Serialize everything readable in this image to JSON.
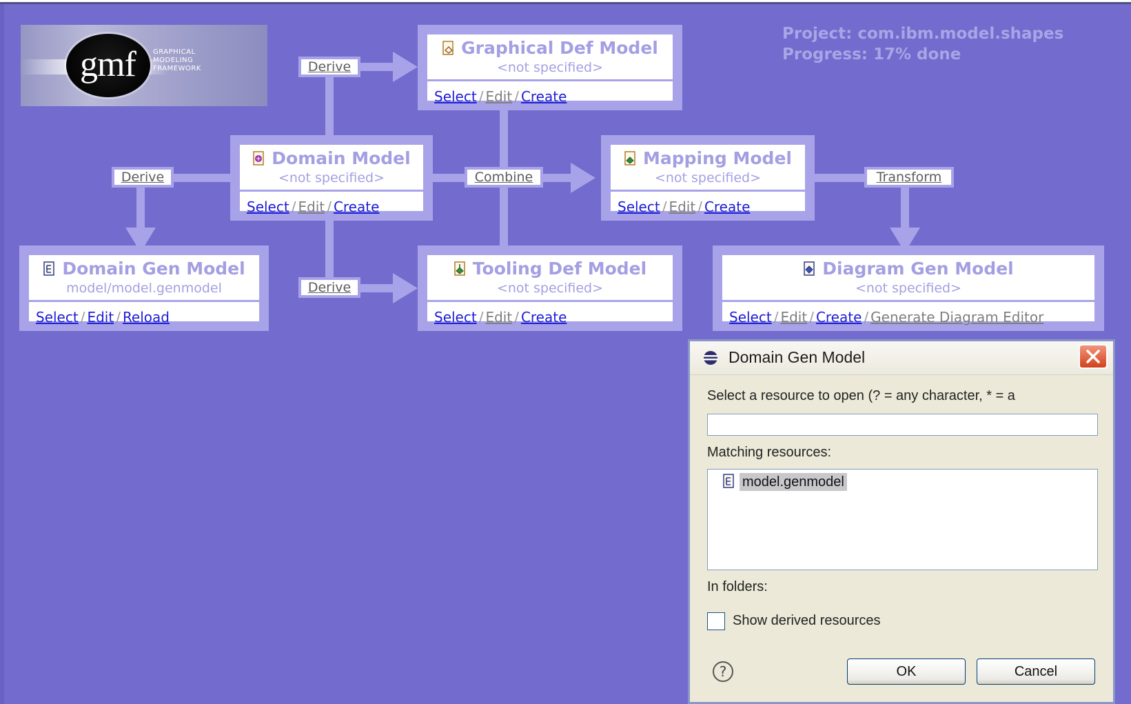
{
  "logo": {
    "mark": "gmf",
    "lines": [
      "GRAPHICAL",
      "MODELING",
      "FRAMEWORK"
    ]
  },
  "project": {
    "line1": "Project: com.ibm.model.shapes",
    "line2": "Progress: 17% done"
  },
  "actions": {
    "derive_top": "Derive",
    "derive_left": "Derive",
    "derive_bottom": "Derive",
    "combine": "Combine",
    "transform": "Transform"
  },
  "boxes": {
    "graphical": {
      "title": "Graphical Def Model",
      "subtitle": "<not specified>",
      "select": "Select",
      "edit": "Edit",
      "create": "Create"
    },
    "domain": {
      "title": "Domain Model",
      "subtitle": "<not specified>",
      "select": "Select",
      "edit": "Edit",
      "create": "Create"
    },
    "mapping": {
      "title": "Mapping Model",
      "subtitle": "<not specified>",
      "select": "Select",
      "edit": "Edit",
      "create": "Create"
    },
    "domain_gen": {
      "title": "Domain Gen Model",
      "subtitle": "model/model.genmodel",
      "select": "Select",
      "edit": "Edit",
      "reload": "Reload"
    },
    "tooling": {
      "title": "Tooling Def Model",
      "subtitle": "<not specified>",
      "select": "Select",
      "edit": "Edit",
      "create": "Create"
    },
    "diagram_gen": {
      "title": "Diagram Gen Model",
      "subtitle": "<not specified>",
      "select": "Select",
      "edit": "Edit",
      "create": "Create",
      "generate": "Generate Diagram Editor"
    }
  },
  "separator": "/",
  "dialog": {
    "title": "Domain Gen Model",
    "prompt": "Select a resource to open (? = any character, * = a",
    "search_value": "",
    "matching_label": "Matching resources:",
    "items": [
      "model.genmodel"
    ],
    "folders_label": "In folders:",
    "show_derived_label": "Show derived resources",
    "show_derived_checked": false,
    "help": "?",
    "ok": "OK",
    "cancel": "Cancel"
  }
}
